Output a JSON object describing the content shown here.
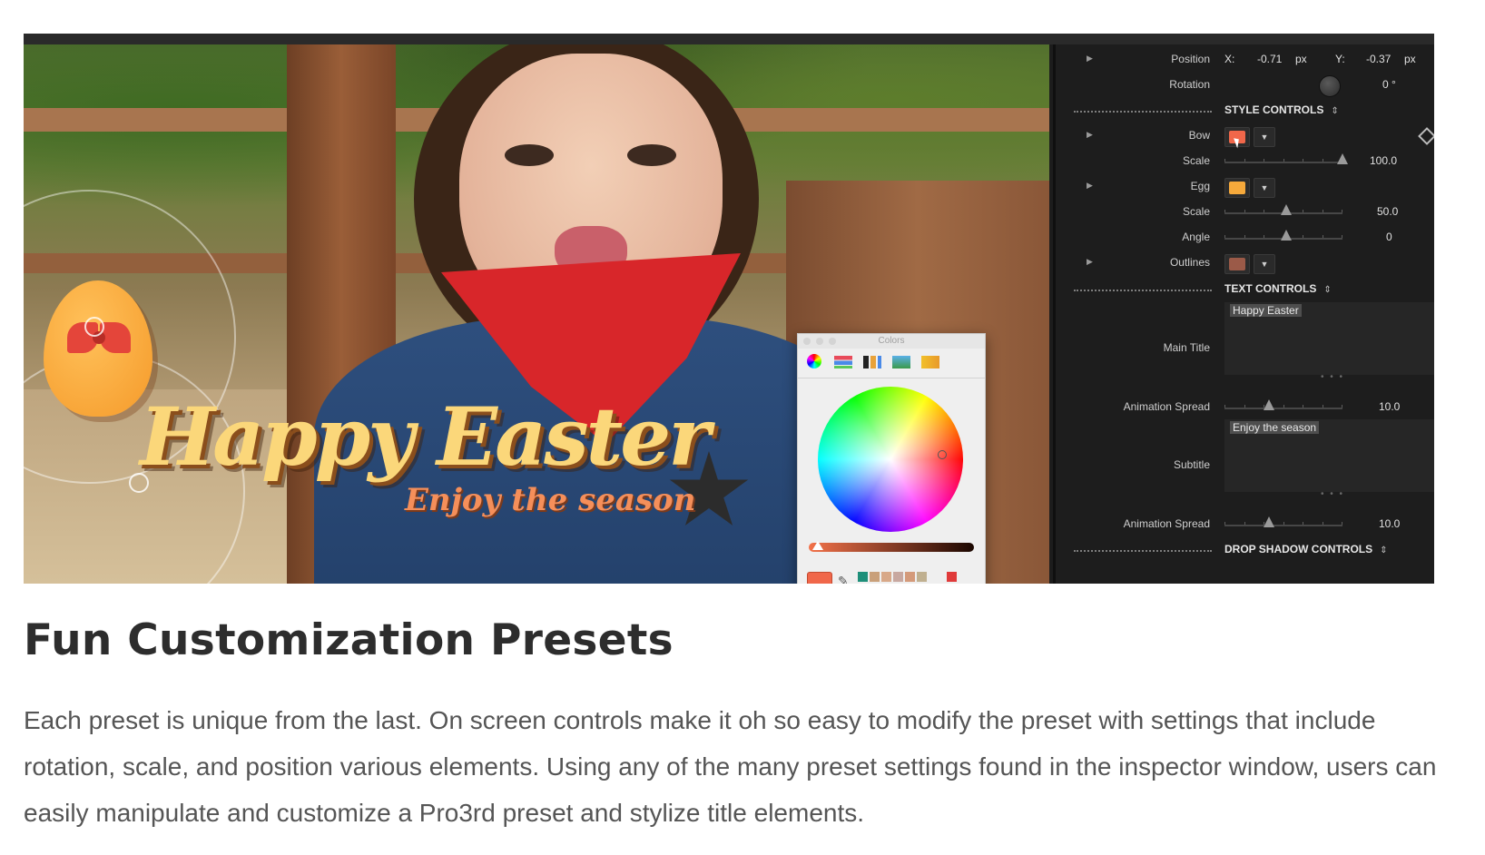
{
  "colors": {
    "accent_bow": "#f0674a",
    "accent_egg": "#f6a93b",
    "accent_outline": "#9b5a48",
    "panel_bg": "#1d1d1d",
    "heading": "#2d2d2d",
    "body": "#555555"
  },
  "viewer": {
    "title_main": "Happy Easter",
    "title_sub": "Enjoy the season"
  },
  "colors_window": {
    "title": "Colors",
    "tabs": [
      "color-wheel-icon",
      "color-sliders-icon",
      "color-palettes-icon",
      "image-palettes-icon",
      "crayons-icon"
    ],
    "current_color": "#f0674a",
    "swatches": [
      "#1e8f7a",
      "#c9a07a",
      "#d8a888",
      "#c8a8a0",
      "#d49a7a",
      "#c0b090",
      "#e03a3a",
      "#1a1a5a",
      "#d03a9a",
      "#a0a0b0",
      "#e08a6a",
      "#e05a4a",
      "#4a3a2a",
      "#6a5a4a"
    ]
  },
  "inspector": {
    "position": {
      "label": "Position",
      "x_label": "X:",
      "x_value": "-0.71",
      "x_unit": "px",
      "y_label": "Y:",
      "y_value": "-0.37",
      "y_unit": "px"
    },
    "rotation": {
      "label": "Rotation",
      "value": "0 °"
    },
    "style_controls": {
      "header": "STYLE CONTROLS",
      "header_arrow": "⇕",
      "bow": {
        "label": "Bow",
        "color": "#f0674a"
      },
      "bow_scale": {
        "label": "Scale",
        "value": "100.0",
        "fraction": 1.0
      },
      "egg": {
        "label": "Egg",
        "color": "#f6a93b"
      },
      "egg_scale": {
        "label": "Scale",
        "value": "50.0",
        "fraction": 0.5
      },
      "angle": {
        "label": "Angle",
        "value": "0",
        "fraction": 0.5
      },
      "outlines": {
        "label": "Outlines",
        "color": "#9b5a48"
      }
    },
    "text_controls": {
      "header": "TEXT CONTROLS",
      "header_arrow": "⇕",
      "main_title": {
        "label": "Main Title",
        "value": "Happy Easter"
      },
      "anim_spread_1": {
        "label": "Animation Spread",
        "value": "10.0",
        "fraction": 0.35
      },
      "subtitle": {
        "label": "Subtitle",
        "value": "Enjoy the season"
      },
      "anim_spread_2": {
        "label": "Animation Spread",
        "value": "10.0",
        "fraction": 0.35
      }
    },
    "drop_shadow_controls": {
      "header": "DROP SHADOW CONTROLS",
      "header_arrow": "⇕"
    }
  },
  "article": {
    "heading": "Fun Customization Presets",
    "body": "Each preset is unique from the last. On screen controls make it oh so easy to modify the preset with settings that include rotation, scale, and position various elements. Using any of the many preset settings found in the inspector window, users can easily manipulate and customize a Pro3rd preset and stylize title elements."
  }
}
